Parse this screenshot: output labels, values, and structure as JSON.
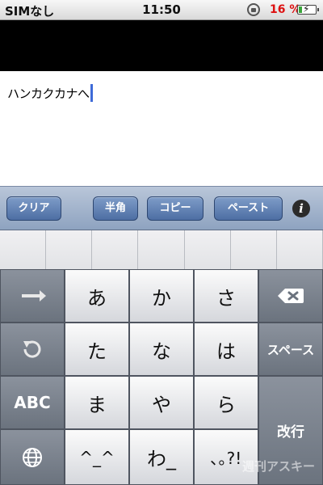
{
  "status_bar": {
    "carrier": "SIMなし",
    "time": "11:50",
    "battery_percent": "16 %",
    "battery_level": 0.16,
    "battery_fill": "#3aa53a"
  },
  "editor": {
    "text": "ハンカクカナへ"
  },
  "toolbar": {
    "clear_label": "クリア",
    "halfwidth_label": "半角",
    "copy_label": "コピー",
    "paste_label": "ペースト",
    "info_label": "i"
  },
  "keyboard": {
    "keys": [
      "あ",
      "か",
      "さ",
      "た",
      "な",
      "は",
      "ま",
      "や",
      "ら",
      "^_^",
      "わ_",
      "､｡?!"
    ],
    "abc_label": "ABC",
    "space_label": "スペース",
    "return_label": "改行",
    "icons": [
      "arrow-right-icon",
      "undo-icon",
      "globe-icon",
      "delete-icon"
    ]
  },
  "watermark": "週刊アスキー"
}
